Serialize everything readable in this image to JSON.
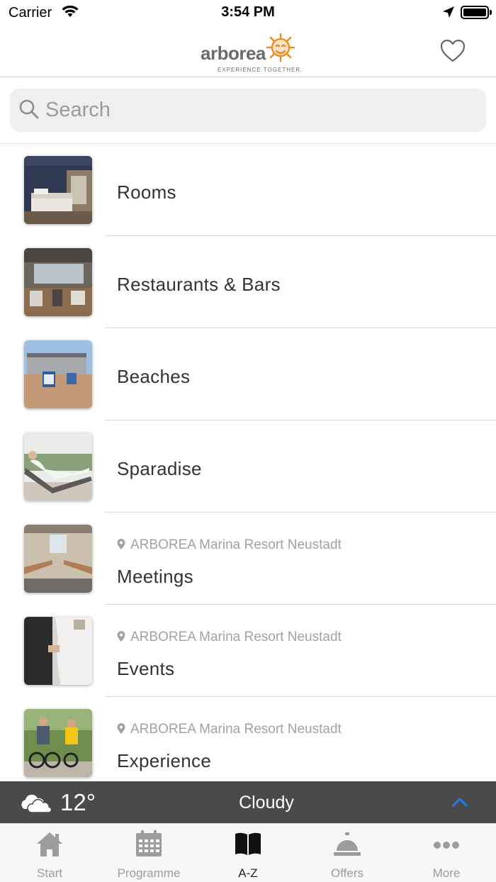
{
  "status_bar": {
    "carrier": "Carrier",
    "time": "3:54 PM",
    "icons": [
      "wifi-icon",
      "location-arrow-icon",
      "battery-icon"
    ]
  },
  "header": {
    "logo_text": "arborea",
    "logo_tagline": "EXPERIENCE.TOGETHER.",
    "favorite_icon": "heart-outline-icon"
  },
  "search": {
    "placeholder": "Search",
    "value": ""
  },
  "items": [
    {
      "title": "Rooms",
      "location": ""
    },
    {
      "title": "Restaurants & Bars",
      "location": ""
    },
    {
      "title": "Beaches",
      "location": ""
    },
    {
      "title": "Sparadise",
      "location": ""
    },
    {
      "title": "Meetings",
      "location": "ARBOREA Marina Resort Neustadt"
    },
    {
      "title": "Events",
      "location": "ARBOREA Marina Resort Neustadt"
    },
    {
      "title": "Experience",
      "location": "ARBOREA Marina Resort Neustadt"
    }
  ],
  "weather": {
    "temperature": "12°",
    "condition": "Cloudy",
    "icon": "cloud-icon"
  },
  "tabs": [
    {
      "label": "Start",
      "icon": "home-icon",
      "active": false
    },
    {
      "label": "Programme",
      "icon": "calendar-icon",
      "active": false
    },
    {
      "label": "A-Z",
      "icon": "book-icon",
      "active": true
    },
    {
      "label": "Offers",
      "icon": "service-bell-icon",
      "active": false
    },
    {
      "label": "More",
      "icon": "more-dots-icon",
      "active": false
    }
  ],
  "colors": {
    "accent": "#1a7cf0",
    "logo_orange": "#f08a1c",
    "weather_bar": "#4a4a4a",
    "tab_inactive": "#9c9c9c"
  }
}
